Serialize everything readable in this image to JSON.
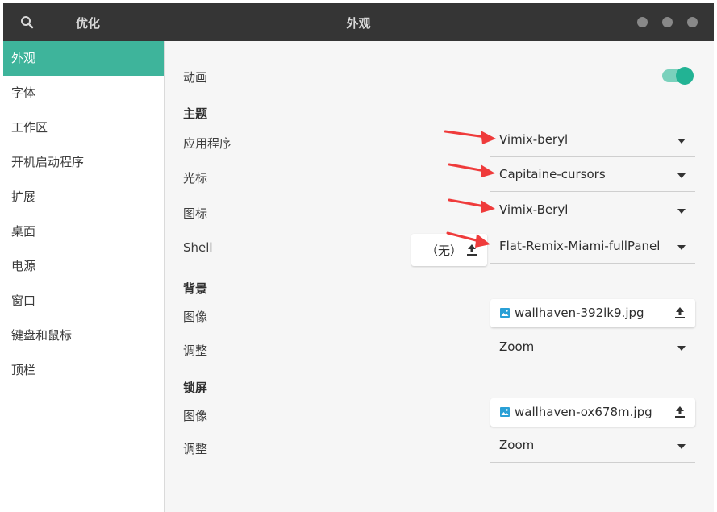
{
  "window": {
    "app_title": "优化",
    "page_title": "外观"
  },
  "sidebar": {
    "items": [
      {
        "label": "外观",
        "active": true
      },
      {
        "label": "字体",
        "active": false
      },
      {
        "label": "工作区",
        "active": false
      },
      {
        "label": "开机启动程序",
        "active": false
      },
      {
        "label": "扩展",
        "active": false
      },
      {
        "label": "桌面",
        "active": false
      },
      {
        "label": "电源",
        "active": false
      },
      {
        "label": "窗口",
        "active": false
      },
      {
        "label": "键盘和鼠标",
        "active": false
      },
      {
        "label": "顶栏",
        "active": false
      }
    ]
  },
  "appearance": {
    "animation": {
      "label": "动画",
      "enabled": true
    },
    "themes": {
      "heading": "主题",
      "applications": {
        "label": "应用程序",
        "value": "Vimix-beryl"
      },
      "cursor": {
        "label": "光标",
        "value": "Capitaine-cursors"
      },
      "icons": {
        "label": "图标",
        "value": "Vimix-Beryl"
      },
      "shell": {
        "label": "Shell",
        "value": "Flat-Remix-Miami-fullPanel",
        "file_button": "（无）"
      }
    },
    "background": {
      "heading": "背景",
      "image": {
        "label": "图像",
        "file": "wallhaven-392lk9.jpg"
      },
      "adjustment": {
        "label": "调整",
        "value": "Zoom"
      }
    },
    "lock_screen": {
      "heading": "锁屏",
      "image": {
        "label": "图像",
        "file": "wallhaven-ox678m.jpg"
      },
      "adjustment": {
        "label": "调整",
        "value": "Zoom"
      }
    }
  },
  "colors": {
    "accent": "#3eb49b",
    "headerbar": "#353535",
    "annotation_arrow": "#ef3b3b",
    "image_icon": "#2aa0d6"
  },
  "icons": [
    "search-icon",
    "window-button-dot",
    "image-file-icon",
    "upload-icon",
    "dropdown-arrow-icon"
  ]
}
